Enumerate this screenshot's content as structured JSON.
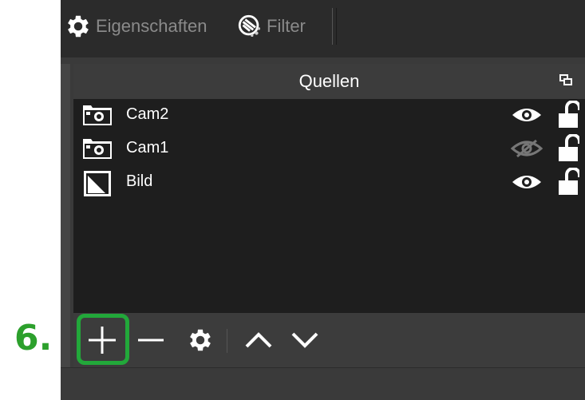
{
  "toolbar": {
    "properties_label": "Eigenschaften",
    "filter_label": "Filter"
  },
  "sources_dock": {
    "title": "Quellen",
    "items": [
      {
        "name": "Cam2",
        "type": "camera-icon",
        "visible": true,
        "locked": false
      },
      {
        "name": "Cam1",
        "type": "camera-icon",
        "visible": false,
        "locked": false
      },
      {
        "name": "Bild",
        "type": "image-icon",
        "visible": true,
        "locked": false
      }
    ],
    "actions": [
      "plus-icon",
      "minus-icon",
      "gear-icon",
      "chevron-up-icon",
      "chevron-down-icon"
    ]
  },
  "annotation": {
    "step": "6.",
    "color": "#22a83a"
  }
}
